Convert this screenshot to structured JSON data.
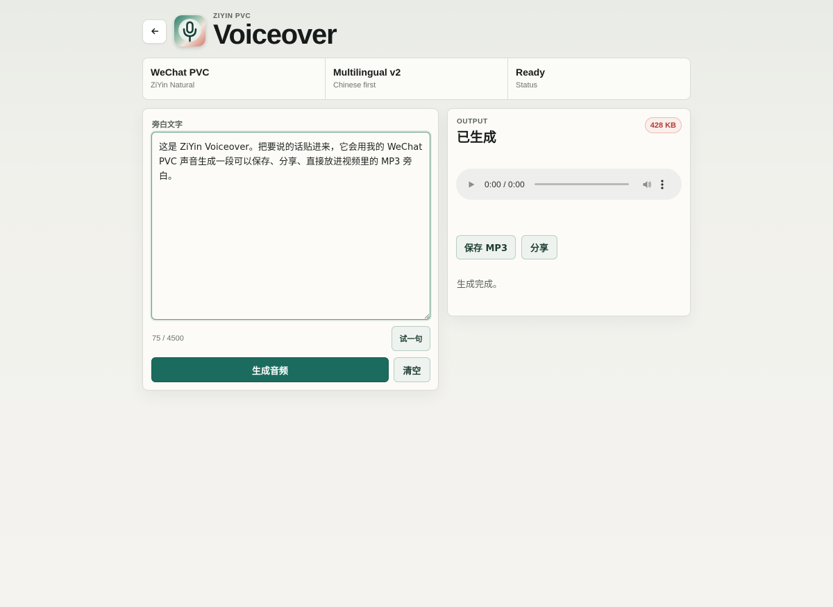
{
  "header": {
    "eyebrow": "ZIYIN PVC",
    "title": "Voiceover"
  },
  "stats": [
    {
      "main": "WeChat PVC",
      "sub": "ZiYin Natural"
    },
    {
      "main": "Multilingual v2",
      "sub": "Chinese first"
    },
    {
      "main": "Ready",
      "sub": "Status"
    }
  ],
  "input": {
    "label": "旁白文字",
    "text": "这是 ZiYin Voiceover。把要说的话贴进来，它会用我的 WeChat PVC 声音生成一段可以保存、分享、直接放进视频里的 MP3 旁白。",
    "char_count": "75 / 4500",
    "try_label": "试一句",
    "generate_label": "生成音频",
    "clear_label": "清空"
  },
  "output": {
    "eyebrow": "OUTPUT",
    "title": "已生成",
    "size_badge": "428 KB",
    "player": {
      "time": "0:00 / 0:00",
      "progress": 0
    },
    "save_label": "保存 MP3",
    "share_label": "分享",
    "status_message": "生成完成。"
  },
  "colors": {
    "accent": "#1b6b5e",
    "badge_text": "#b23e34",
    "badge_border": "#ecbcb4"
  },
  "icons": {
    "back": "arrow-left-icon",
    "app": "microphone-icon",
    "play": "play-icon",
    "volume": "volume-icon",
    "more": "more-vertical-icon"
  }
}
